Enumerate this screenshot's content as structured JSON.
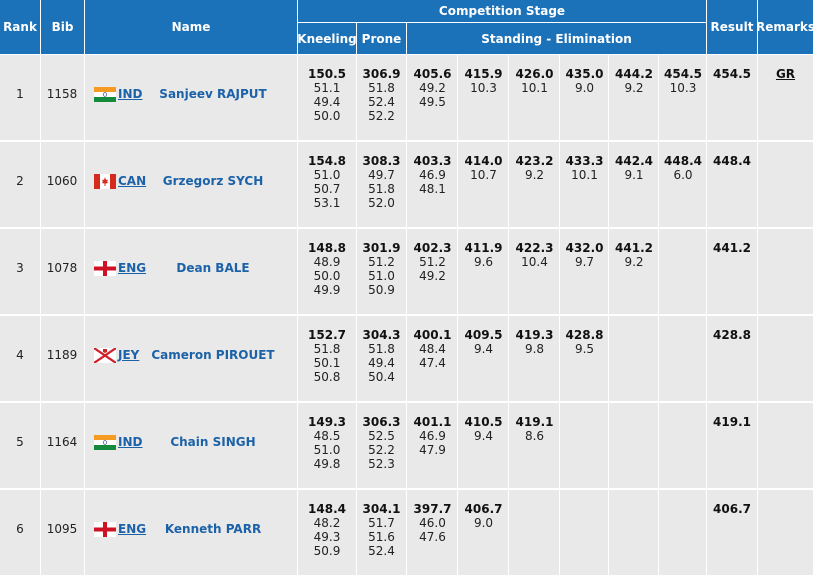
{
  "headers": {
    "rank": "Rank",
    "bib": "Bib",
    "name": "Name",
    "competition_stage": "Competition Stage",
    "kneeling": "Kneeling",
    "prone": "Prone",
    "standing": "Standing - Elimination",
    "result": "Result",
    "remarks": "Remarks"
  },
  "colors": {
    "header_bg": "#1c72b8",
    "row_bg": "#e9e9e9",
    "link": "#1c62a8"
  },
  "rows": [
    {
      "rank": "1",
      "bib": "1158",
      "country": "IND",
      "flag": "india-flag-icon",
      "name": "Sanjeev RAJPUT",
      "kneeling": [
        "150.5",
        "51.1",
        "49.4",
        "50.0"
      ],
      "prone": [
        "306.9",
        "51.8",
        "52.4",
        "52.2"
      ],
      "standing": [
        [
          "405.6",
          "49.2",
          "49.5"
        ],
        [
          "415.9",
          "10.3"
        ],
        [
          "426.0",
          "10.1"
        ],
        [
          "435.0",
          "9.0"
        ],
        [
          "444.2",
          "9.2"
        ],
        [
          "454.5",
          "10.3"
        ]
      ],
      "result": "454.5",
      "remarks": "GR"
    },
    {
      "rank": "2",
      "bib": "1060",
      "country": "CAN",
      "flag": "canada-flag-icon",
      "name": "Grzegorz SYCH",
      "kneeling": [
        "154.8",
        "51.0",
        "50.7",
        "53.1"
      ],
      "prone": [
        "308.3",
        "49.7",
        "51.8",
        "52.0"
      ],
      "standing": [
        [
          "403.3",
          "46.9",
          "48.1"
        ],
        [
          "414.0",
          "10.7"
        ],
        [
          "423.2",
          "9.2"
        ],
        [
          "433.3",
          "10.1"
        ],
        [
          "442.4",
          "9.1"
        ],
        [
          "448.4",
          "6.0"
        ]
      ],
      "result": "448.4",
      "remarks": ""
    },
    {
      "rank": "3",
      "bib": "1078",
      "country": "ENG",
      "flag": "england-flag-icon",
      "name": "Dean BALE",
      "kneeling": [
        "148.8",
        "48.9",
        "50.0",
        "49.9"
      ],
      "prone": [
        "301.9",
        "51.2",
        "51.0",
        "50.9"
      ],
      "standing": [
        [
          "402.3",
          "51.2",
          "49.2"
        ],
        [
          "411.9",
          "9.6"
        ],
        [
          "422.3",
          "10.4"
        ],
        [
          "432.0",
          "9.7"
        ],
        [
          "441.2",
          "9.2"
        ],
        []
      ],
      "result": "441.2",
      "remarks": ""
    },
    {
      "rank": "4",
      "bib": "1189",
      "country": "JEY",
      "flag": "jersey-flag-icon",
      "name": "Cameron PIROUET",
      "kneeling": [
        "152.7",
        "51.8",
        "50.1",
        "50.8"
      ],
      "prone": [
        "304.3",
        "51.8",
        "49.4",
        "50.4"
      ],
      "standing": [
        [
          "400.1",
          "48.4",
          "47.4"
        ],
        [
          "409.5",
          "9.4"
        ],
        [
          "419.3",
          "9.8"
        ],
        [
          "428.8",
          "9.5"
        ],
        [],
        []
      ],
      "result": "428.8",
      "remarks": ""
    },
    {
      "rank": "5",
      "bib": "1164",
      "country": "IND",
      "flag": "india-flag-icon",
      "name": "Chain SINGH",
      "kneeling": [
        "149.3",
        "48.5",
        "51.0",
        "49.8"
      ],
      "prone": [
        "306.3",
        "52.5",
        "52.2",
        "52.3"
      ],
      "standing": [
        [
          "401.1",
          "46.9",
          "47.9"
        ],
        [
          "410.5",
          "9.4"
        ],
        [
          "419.1",
          "8.6"
        ],
        [],
        [],
        []
      ],
      "result": "419.1",
      "remarks": ""
    },
    {
      "rank": "6",
      "bib": "1095",
      "country": "ENG",
      "flag": "england-flag-icon",
      "name": "Kenneth PARR",
      "kneeling": [
        "148.4",
        "48.2",
        "49.3",
        "50.9"
      ],
      "prone": [
        "304.1",
        "51.7",
        "51.6",
        "52.4"
      ],
      "standing": [
        [
          "397.7",
          "46.0",
          "47.6"
        ],
        [
          "406.7",
          "9.0"
        ],
        [],
        [],
        [],
        []
      ],
      "result": "406.7",
      "remarks": ""
    }
  ]
}
